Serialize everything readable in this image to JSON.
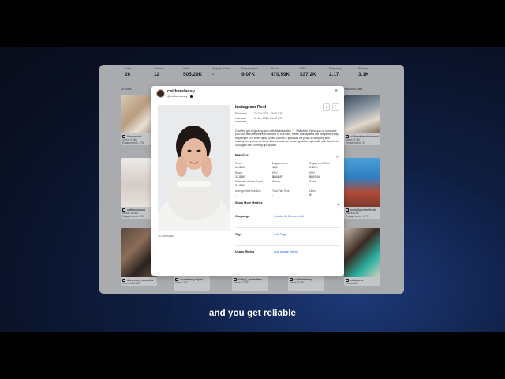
{
  "caption": "and you get reliable",
  "stats": [
    {
      "label": "Posts",
      "value": "26"
    },
    {
      "label": "Creators",
      "value": "12"
    },
    {
      "label": "Views",
      "value": "505.29K"
    },
    {
      "label": "Engaged Views",
      "value": "-"
    },
    {
      "label": "Engagements",
      "value": "9.07K"
    },
    {
      "label": "Reach",
      "value": "470.59K"
    },
    {
      "label": "EMV",
      "value": "$37.2K"
    },
    {
      "label": "Frequency",
      "value": "2.17"
    },
    {
      "label": "Potency",
      "value": "3.1K"
    }
  ],
  "grid": {
    "posts_count": "26 posts",
    "published_date_label": "Published Date",
    "cards": [
      {
        "handle": "ilonemood",
        "sub1": "Views: 3.56M",
        "sub2": "Engagements: 278"
      },
      {
        "handle": "bre",
        "sub1": "",
        "sub2": ""
      },
      {
        "handle": "calthersfasshionandbeauty",
        "sub1": "Views: 3.21K",
        "sub2": "Engagements: 29"
      },
      {
        "handle": "calthersiassy",
        "sub1": "Views: 14.59K",
        "sub2": "Engagements: 123"
      },
      {
        "handle": "sociallyfuturefeeds",
        "sub1": "Views: 6.8K",
        "sub2": "Engagements: 1,778"
      },
      {
        "handle": "daneesa_mymicks",
        "sub1": "Views: 250.98K",
        "sub2": ""
      },
      {
        "handle": "accatemoperpar",
        "sub1": "Views: 187",
        "sub2": ""
      },
      {
        "handle": "katlyn_mcmullen",
        "sub1": "Views: 3.32K",
        "sub2": ""
      },
      {
        "handle": "calthersiassy",
        "sub1": "Views: 5.92K",
        "sub2": ""
      },
      {
        "handle": "nikkilonis",
        "sub1": "Views: 547",
        "sub2": ""
      }
    ]
  },
  "modal": {
    "creator_name": "caitherslassy",
    "creator_handle": "@caithersiassy",
    "close_icon": "×",
    "post_type": "Instagram Reel",
    "published_label": "Published",
    "published_value": "28 Oct 2024, 18:08 UTC",
    "refreshed_label": "Last auto refreshed",
    "refreshed_value": "11 Jun 2025, 21:43 UTC",
    "description": "Give the gift of glowing skin with Strandanden ✨ ! Whether it's for you or someone you love who deserves a moment of self care, these holiday sets are the perfect way to pamper. I've been using Shani Darden's products for years to keep my skin healthy and plump so these kits are such an amazing value especially with Sephora's Savings Event coming up! @ #ad",
    "metrics_title": "Metrics",
    "metrics": [
      {
        "label": "Views",
        "value": "14.59K"
      },
      {
        "label": "Engagements",
        "value": "123"
      },
      {
        "label": "Engagement Rate",
        "value": "0.12%"
      },
      {
        "label": "Reach",
        "value": "13.56K"
      },
      {
        "label": "ERV",
        "value": "$864.87"
      },
      {
        "label": "SMV",
        "value": "$863.69"
      },
      {
        "label": "Estimates at time of post",
        "value": "31.53K"
      },
      {
        "label": "Shares",
        "value": "-"
      },
      {
        "label": "Saves",
        "value": "-"
      },
      {
        "label": "Average View Duration",
        "value": "-"
      },
      {
        "label": "Total Play Time",
        "value": "-"
      },
      {
        "label": "Likes",
        "value": "93"
      }
    ],
    "show_more": "Show More Metrics",
    "community_label": "In Community",
    "campaign_label": "Campaign",
    "campaign_value": "CreatorIQ Connect LA",
    "tags_label": "Tags",
    "tags_value": "Add Tags",
    "usage_label": "Usage Rights",
    "usage_value": "Add Usage Rights"
  }
}
